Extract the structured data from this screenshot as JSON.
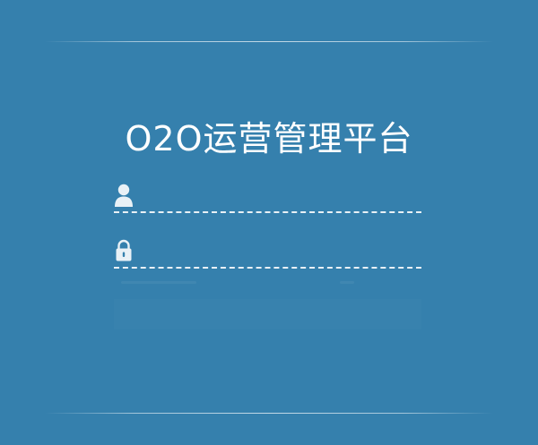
{
  "app": {
    "title": "O2O运营管理平台"
  },
  "login": {
    "username": {
      "icon": "user-icon",
      "placeholder": "",
      "value": ""
    },
    "password": {
      "icon": "lock-icon",
      "placeholder": "",
      "value": ""
    }
  },
  "colors": {
    "background": "#3580ad",
    "text": "#ffffff",
    "divider": "#e9f1f6"
  }
}
